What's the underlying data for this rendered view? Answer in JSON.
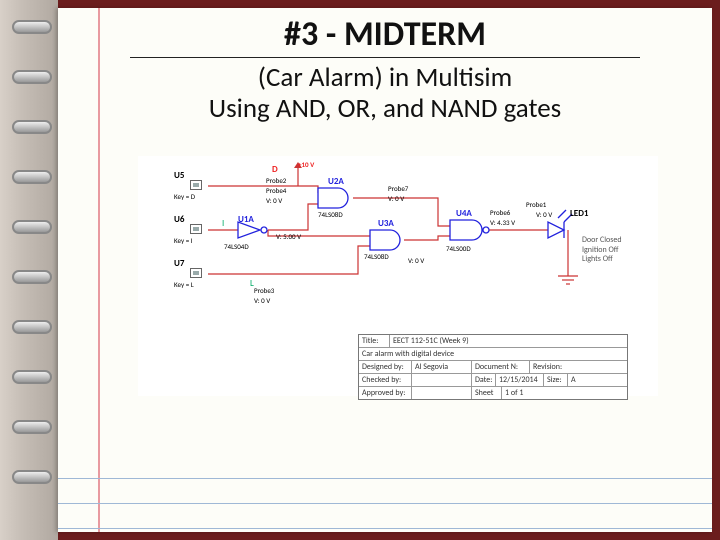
{
  "title": "#3 - MIDTERM",
  "subtitle_line1": "(Car Alarm) in Multisim",
  "subtitle_line2": "Using AND, OR, and NAND gates",
  "switches": {
    "u5": {
      "ref": "U5",
      "key": "Key = D"
    },
    "u6": {
      "ref": "U6",
      "key": "Key = I"
    },
    "u7": {
      "ref": "U7",
      "key": "Key = L"
    }
  },
  "gates": {
    "u1a": {
      "ref": "U1A",
      "part": "74LS04D"
    },
    "u2a": {
      "ref": "U2A",
      "part": "74LS08D"
    },
    "u3a": {
      "ref": "U3A",
      "part": "74LS08D"
    },
    "u4a": {
      "ref": "U4A",
      "part": "74LS00D"
    }
  },
  "signals": {
    "d": "D",
    "i": "I",
    "l": "L"
  },
  "probes": {
    "p2": "Probe2",
    "p4": "Probe4",
    "p3": "Probe3",
    "p7": "Probe7",
    "p6": "Probe6",
    "p1": "Probe1"
  },
  "voltages": {
    "v0a": "V: 0 V",
    "v0b": "V: 0 V",
    "v0c": "V: 0 V",
    "v0d": "V: 0 V",
    "v0e": "V: 0 V",
    "v5": "V: 5.00 V",
    "vdc": "+10 V",
    "probe6v": "V: 4.33 V"
  },
  "led": {
    "ref": "LED1",
    "legend1": "Door Closed",
    "legend2": "Ignition Off",
    "legend3": "Lights Off"
  },
  "titleblock": {
    "title_label": "Title:",
    "title_value": "EECT 112-51C (Week 9)",
    "desc": "Car alarm with digital device",
    "designed_label": "Designed by:",
    "designed_value": "Al Segovia",
    "doc_label": "Document N:",
    "rev_label": "Revision:",
    "checked_label": "Checked by:",
    "date_label": "Date:",
    "date_value": "12/15/2014",
    "size_label": "Size:",
    "size_value": "A",
    "approved_label": "Approved by:",
    "sheet_label": "Sheet",
    "sheet_value": "1   of   1"
  }
}
